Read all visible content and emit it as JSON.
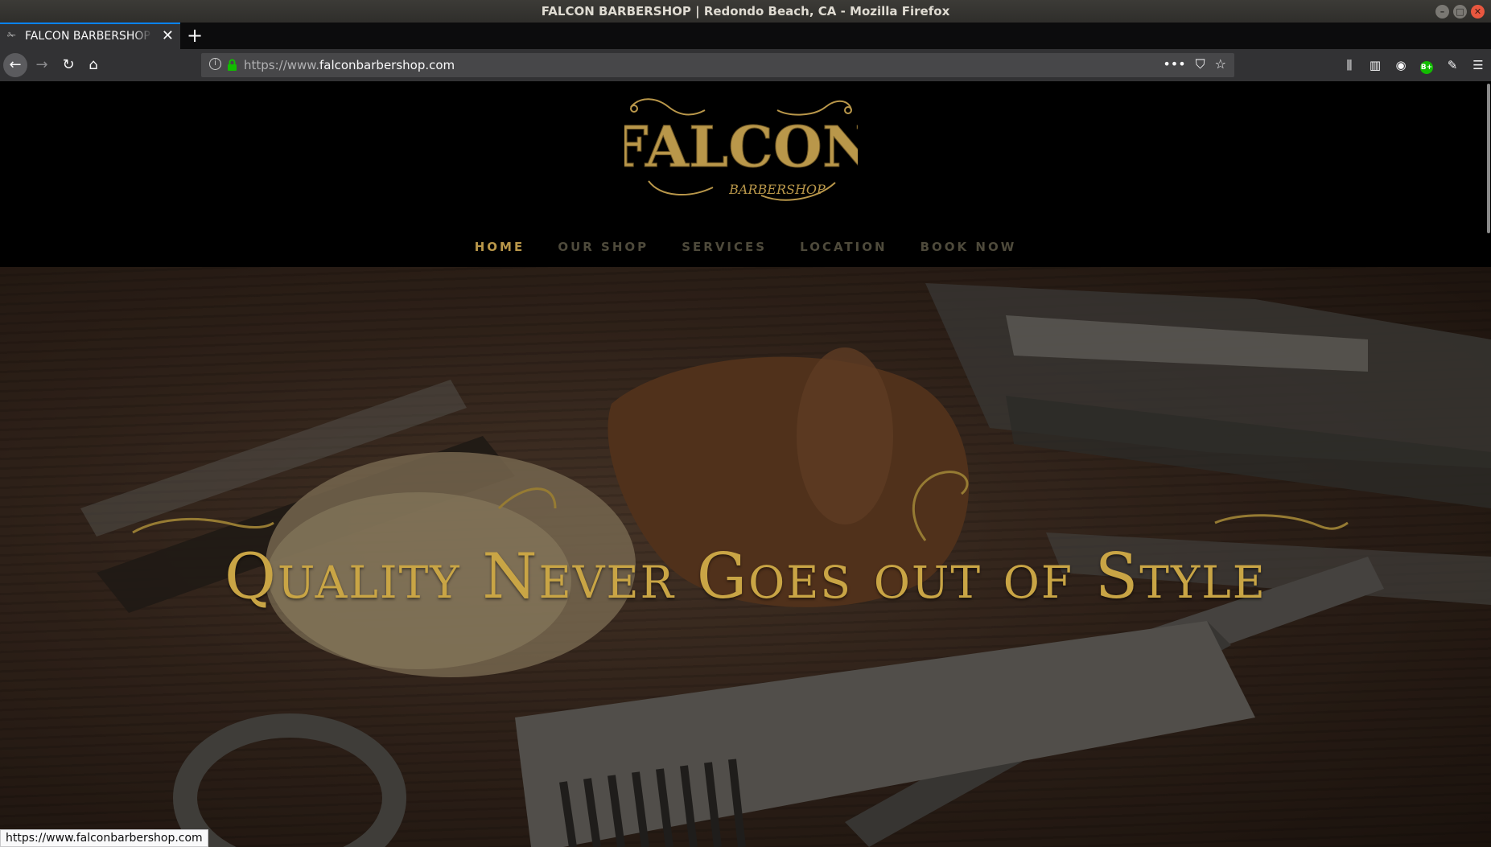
{
  "window": {
    "title": "FALCON BARBERSHOP | Redondo Beach, CA - Mozilla Firefox"
  },
  "tab": {
    "title": "FALCON BARBERSHOP | Redondo Beach, CA",
    "close": "✕",
    "new_tab": "+"
  },
  "nav_toolbar": {
    "back": "←",
    "forward": "→",
    "reload": "↻",
    "home": "⌂"
  },
  "urlbar": {
    "scheme": "https://www.",
    "domain": "falconbarbershop.com",
    "page_actions": "•••"
  },
  "site": {
    "logo_line1": "FALCON",
    "logo_line2": "BARBERSHOP",
    "nav": [
      {
        "label": "HOME",
        "active": true
      },
      {
        "label": "OUR SHOP",
        "active": false
      },
      {
        "label": "SERVICES",
        "active": false
      },
      {
        "label": "LOCATION",
        "active": false
      },
      {
        "label": "BOOK NOW",
        "active": false
      }
    ],
    "tagline": "Quality Never Goes out of Style",
    "accent_color": "#c9a545"
  },
  "status": {
    "url": "https://www.falconbarbershop.com"
  }
}
